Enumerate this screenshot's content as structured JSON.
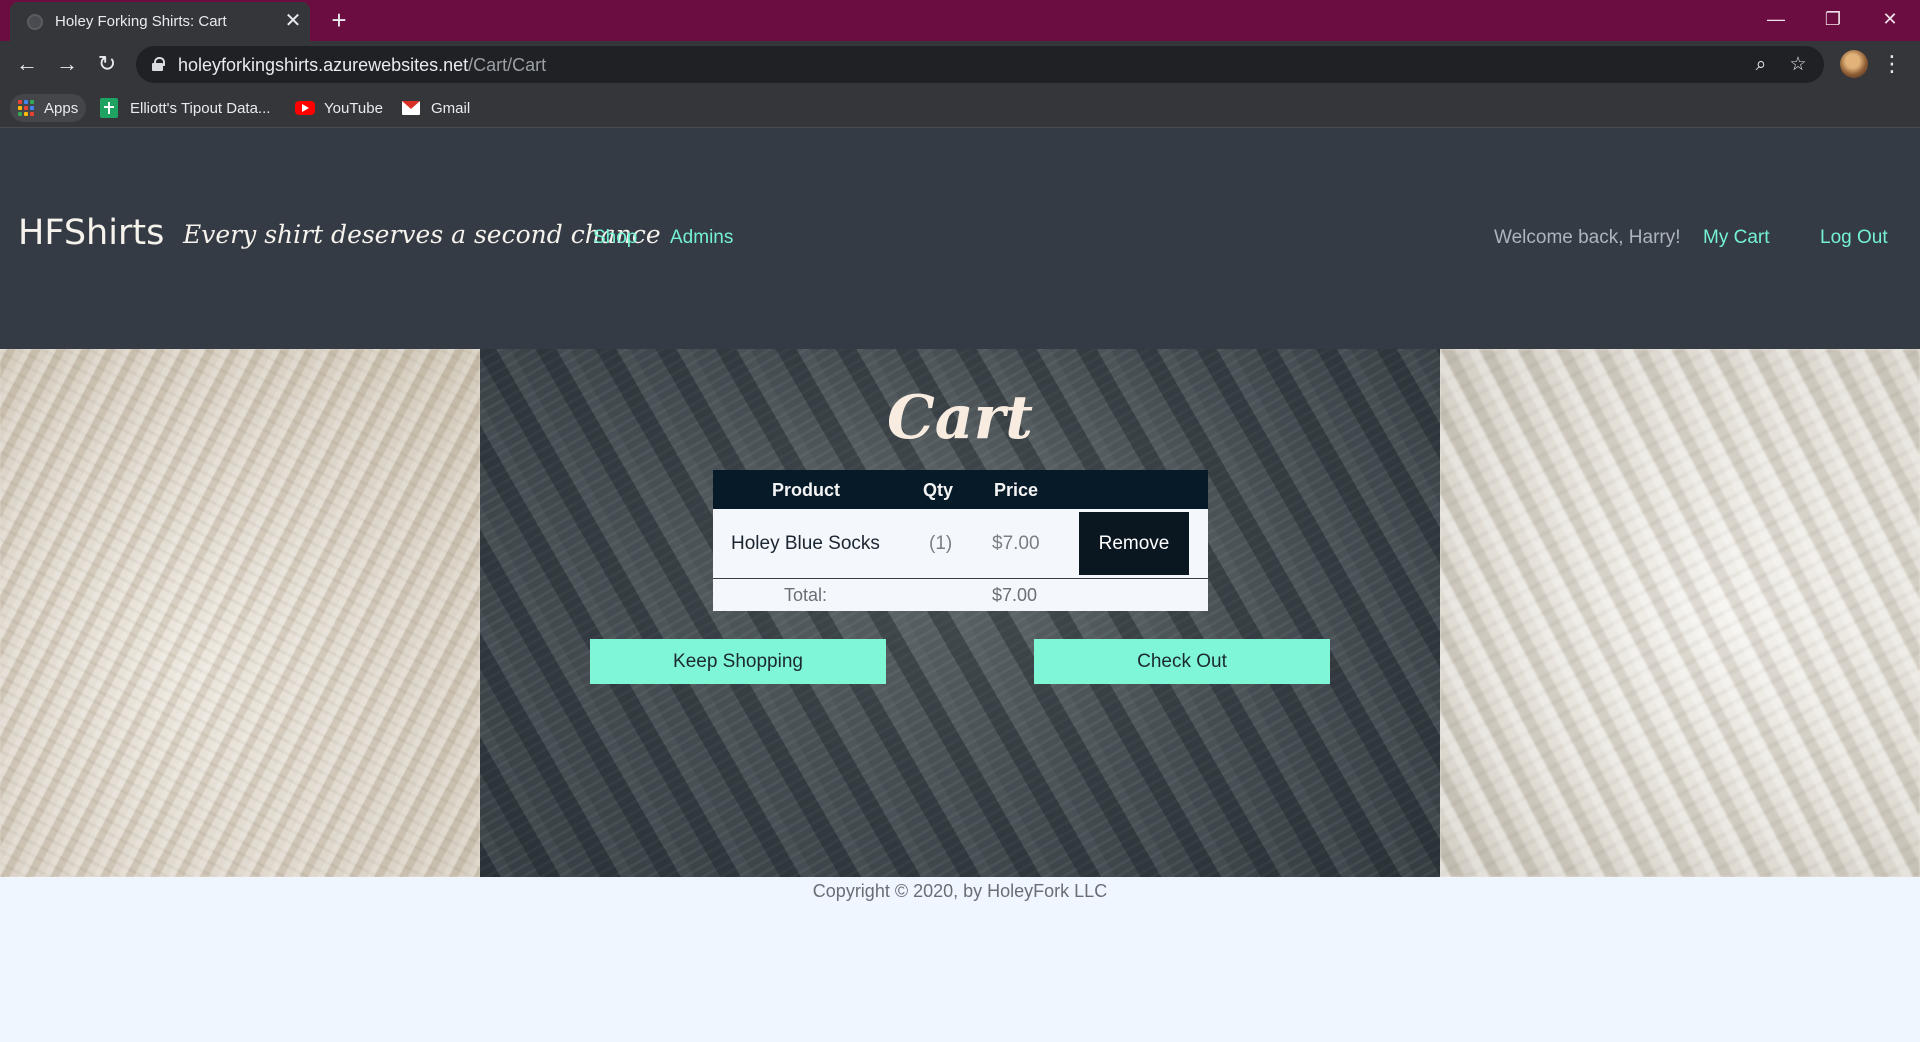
{
  "browser": {
    "tab_title": "Holey Forking Shirts: Cart",
    "url_host": "holeyforkingshirts.azurewebsites.net",
    "url_path": "/Cart/Cart",
    "bookmarks": [
      "Apps",
      "Elliott's Tipout Data...",
      "YouTube",
      "Gmail"
    ]
  },
  "header": {
    "brand": "HFShirts",
    "tagline": "Every shirt deserves a second chance",
    "nav": [
      "Shop",
      "Admins"
    ],
    "welcome": "Welcome back, Harry!",
    "cart_link": "My Cart",
    "logout_link": "Log Out"
  },
  "cart": {
    "title": "Cart",
    "columns": [
      "Product",
      "Qty",
      "Price"
    ],
    "items": [
      {
        "product": "Holey Blue Socks",
        "qty": "(1)",
        "price": "$7.00",
        "action": "Remove"
      }
    ],
    "total_label": "Total:",
    "total_value": "$7.00",
    "keep_shopping": "Keep Shopping",
    "check_out": "Check Out"
  },
  "footer": {
    "copyright": "Copyright © 2020, by HoleyFork LLC"
  },
  "colors": {
    "tabbar": "#6b0d40",
    "header_bg": "#353b45",
    "accent": "#74f2d2",
    "button_bg": "#7ff7d6",
    "table_head": "#061a28"
  }
}
